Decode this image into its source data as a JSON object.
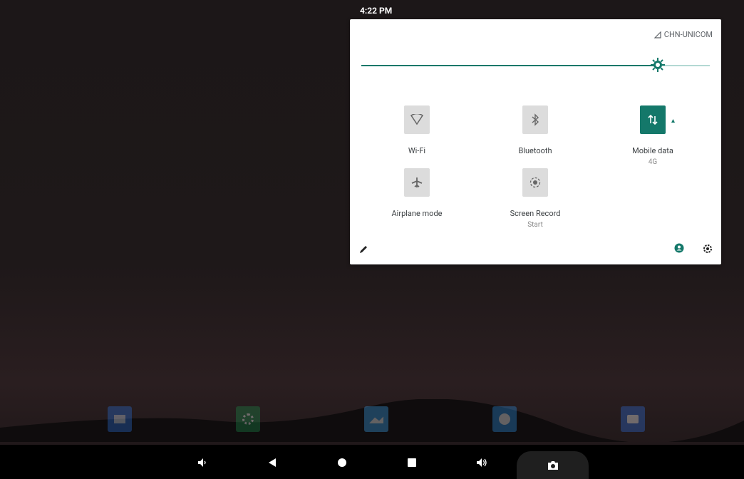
{
  "status_bar": {
    "time": "4:22 PM"
  },
  "quick_settings": {
    "carrier": "CHN-UNICOM",
    "brightness_level": 0.85,
    "tiles": [
      {
        "label": "Wi-Fi",
        "sub": "",
        "icon": "wifi-icon",
        "active": false
      },
      {
        "label": "Bluetooth",
        "sub": "",
        "icon": "bluetooth-icon",
        "active": false
      },
      {
        "label": "Mobile data",
        "sub": "4G",
        "icon": "mobile-data-icon",
        "active": true
      },
      {
        "label": "Airplane mode",
        "sub": "",
        "icon": "airplane-icon",
        "active": false
      },
      {
        "label": "Screen Record",
        "sub": "Start",
        "icon": "screen-record-icon",
        "active": false
      }
    ]
  },
  "dock": [
    "files-icon",
    "settings-app-icon",
    "gallery-icon",
    "browser-icon",
    "camera-app-icon"
  ],
  "nav_bar": [
    "volume-down-icon",
    "back-icon",
    "home-icon",
    "recents-icon",
    "volume-up-icon",
    "screenshot-icon"
  ],
  "colors": {
    "accent": "#14786a",
    "tile_inactive": "#dcdcdc"
  }
}
